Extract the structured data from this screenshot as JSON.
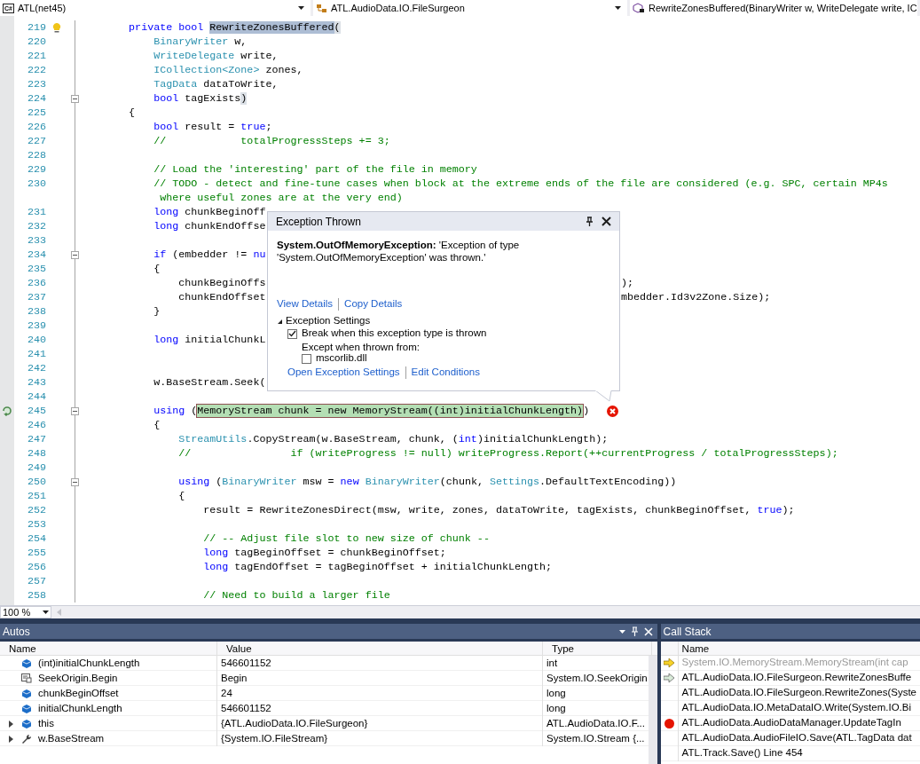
{
  "navigation_bar": {
    "project_badge": "C#",
    "project": "ATL(net45)",
    "type": "ATL.AudioData.IO.FileSurgeon",
    "member": "RewriteZonesBuffered(BinaryWriter w, WriteDelegate write, IC"
  },
  "editor": {
    "lines": [
      {
        "number": "219",
        "fold": false,
        "kind": "suggestion",
        "tokens": [
          {
            "kind": "keyword",
            "text": "        private bool "
          },
          {
            "kind": "selection",
            "text": "RewriteZonesBuffered"
          },
          {
            "kind": "brace-match",
            "text": "("
          }
        ]
      },
      {
        "number": "220",
        "fold": false,
        "tokens": [
          {
            "kind": "type",
            "text": "            BinaryWriter"
          },
          {
            "kind": "plain",
            "text": " w,"
          }
        ]
      },
      {
        "number": "221",
        "fold": false,
        "tokens": [
          {
            "kind": "type",
            "text": "            WriteDelegate"
          },
          {
            "kind": "plain",
            "text": " write,"
          }
        ]
      },
      {
        "number": "222",
        "fold": false,
        "tokens": [
          {
            "kind": "type",
            "text": "            ICollection<Zone>"
          },
          {
            "kind": "plain",
            "text": " zones,"
          }
        ]
      },
      {
        "number": "223",
        "fold": false,
        "tokens": [
          {
            "kind": "type",
            "text": "            TagData"
          },
          {
            "kind": "plain",
            "text": " dataToWrite,"
          }
        ]
      },
      {
        "number": "224",
        "fold": true,
        "tokens": [
          {
            "kind": "keyword",
            "text": "            bool"
          },
          {
            "kind": "plain",
            "text": " tagExists"
          },
          {
            "kind": "brace-match",
            "text": ")"
          }
        ]
      },
      {
        "number": "225",
        "fold": false,
        "tokens": [
          {
            "kind": "plain",
            "text": "        {"
          }
        ]
      },
      {
        "number": "226",
        "fold": false,
        "tokens": [
          {
            "kind": "keyword",
            "text": "            bool"
          },
          {
            "kind": "plain",
            "text": " result = "
          },
          {
            "kind": "keyword",
            "text": "true"
          },
          {
            "kind": "plain",
            "text": ";"
          }
        ]
      },
      {
        "number": "227",
        "fold": false,
        "tokens": [
          {
            "kind": "comment",
            "text": "            //            totalProgressSteps += 3;"
          }
        ]
      },
      {
        "number": "228",
        "fold": false
      },
      {
        "number": "229",
        "fold": false,
        "tokens": [
          {
            "kind": "comment",
            "text": "            // Load the 'interesting' part of the file in memory"
          }
        ]
      },
      {
        "number": "230",
        "fold": false,
        "tokens": [
          {
            "kind": "comment",
            "text": "            // TODO - detect and fine-tune cases when block at the extreme ends of the file are considered (e.g. SPC, certain MP4s"
          }
        ]
      },
      {
        "fold": false,
        "tokens": [
          {
            "kind": "comment",
            "text": "             where useful zones are at the very end)"
          }
        ]
      },
      {
        "number": "231",
        "fold": false,
        "tokens": [
          {
            "kind": "keyword",
            "text": "            long"
          },
          {
            "kind": "plain",
            "text": " chunkBeginOff"
          }
        ]
      },
      {
        "number": "232",
        "fold": false,
        "tokens": [
          {
            "kind": "keyword",
            "text": "            long"
          },
          {
            "kind": "plain",
            "text": " chunkEndOffse"
          }
        ]
      },
      {
        "number": "233",
        "fold": false
      },
      {
        "number": "234",
        "fold": true,
        "tokens": [
          {
            "kind": "keyword",
            "text": "            if"
          },
          {
            "kind": "plain",
            "text": " (embedder != "
          },
          {
            "kind": "keyword",
            "text": "nu"
          }
        ]
      },
      {
        "number": "235",
        "fold": false,
        "tokens": [
          {
            "kind": "plain",
            "text": "            {"
          }
        ]
      },
      {
        "number": "236",
        "fold": false,
        "tokens": [
          {
            "kind": "plain",
            "text": "                chunkBeginOffs"
          }
        ],
        "right_tokens": [
          {
            "text": ");"
          }
        ]
      },
      {
        "number": "237",
        "fold": false,
        "tokens": [
          {
            "kind": "plain",
            "text": "                chunkEndOffset"
          }
        ],
        "right_tokens": [
          {
            "text": "mbedder.Id3v2Zone.Size);"
          }
        ]
      },
      {
        "number": "238",
        "fold": false,
        "tokens": [
          {
            "kind": "plain",
            "text": "            }"
          }
        ]
      },
      {
        "number": "239",
        "fold": false
      },
      {
        "number": "240",
        "fold": false,
        "tokens": [
          {
            "kind": "keyword",
            "text": "            long"
          },
          {
            "kind": "plain",
            "text": " initialChunkL"
          }
        ]
      },
      {
        "number": "241",
        "fold": false
      },
      {
        "number": "242",
        "fold": false
      },
      {
        "number": "243",
        "fold": false,
        "tokens": [
          {
            "kind": "plain",
            "text": "            w.BaseStream.Seek("
          }
        ]
      },
      {
        "number": "244",
        "fold": false
      },
      {
        "number": "245",
        "fold": true,
        "kind": "exception-point",
        "tokens": [
          {
            "kind": "keyword",
            "text": "            using"
          },
          {
            "kind": "plain",
            "text": " ("
          },
          {
            "kind": "current-statement",
            "text": "MemoryStream chunk = new MemoryStream((int)initialChunkLength)"
          },
          {
            "kind": "plain",
            "text": ")"
          }
        ]
      },
      {
        "number": "246",
        "fold": false,
        "tokens": [
          {
            "kind": "plain",
            "text": "            {"
          }
        ]
      },
      {
        "number": "247",
        "fold": false,
        "tokens": [
          {
            "kind": "type",
            "text": "                StreamUtils"
          },
          {
            "kind": "plain",
            "text": ".CopyStream(w.BaseStream, chunk, ("
          },
          {
            "kind": "keyword",
            "text": "int"
          },
          {
            "kind": "plain",
            "text": ")initialChunkLength);"
          }
        ]
      },
      {
        "number": "248",
        "fold": false,
        "tokens": [
          {
            "kind": "comment",
            "text": "                //                if (writeProgress != null) writeProgress.Report(++currentProgress / totalProgressSteps);"
          }
        ]
      },
      {
        "number": "249",
        "fold": false
      },
      {
        "number": "250",
        "fold": true,
        "tokens": [
          {
            "kind": "keyword",
            "text": "                using"
          },
          {
            "kind": "plain",
            "text": " ("
          },
          {
            "kind": "type",
            "text": "BinaryWriter"
          },
          {
            "kind": "plain",
            "text": " msw = "
          },
          {
            "kind": "keyword",
            "text": "new "
          },
          {
            "kind": "type",
            "text": "BinaryWriter"
          },
          {
            "kind": "plain",
            "text": "(chunk, "
          },
          {
            "kind": "type",
            "text": "Settings"
          },
          {
            "kind": "plain",
            "text": ".DefaultTextEncoding))"
          }
        ]
      },
      {
        "number": "251",
        "fold": false,
        "tokens": [
          {
            "kind": "plain",
            "text": "                {"
          }
        ]
      },
      {
        "number": "252",
        "fold": false,
        "tokens": [
          {
            "kind": "plain",
            "text": "                    result = RewriteZonesDirect(msw, write, zones, dataToWrite, tagExists, chunkBeginOffset, "
          },
          {
            "kind": "keyword",
            "text": "true"
          },
          {
            "kind": "plain",
            "text": ");"
          }
        ]
      },
      {
        "number": "253",
        "fold": false
      },
      {
        "number": "254",
        "fold": false,
        "tokens": [
          {
            "kind": "comment",
            "text": "                    // -- Adjust file slot to new size of chunk --"
          }
        ]
      },
      {
        "number": "255",
        "fold": false,
        "tokens": [
          {
            "kind": "keyword",
            "text": "                    long"
          },
          {
            "kind": "plain",
            "text": " tagBeginOffset = chunkBeginOffset;"
          }
        ]
      },
      {
        "number": "256",
        "fold": false,
        "tokens": [
          {
            "kind": "keyword",
            "text": "                    long"
          },
          {
            "kind": "plain",
            "text": " tagEndOffset = tagBeginOffset + initialChunkLength;"
          }
        ]
      },
      {
        "number": "257",
        "fold": false
      },
      {
        "number": "258",
        "fold": false,
        "tokens": [
          {
            "kind": "comment",
            "text": "                    // Need to build a larger file"
          }
        ]
      }
    ],
    "zoom": "100 %"
  },
  "exception_popup": {
    "title": "Exception Thrown",
    "message": "**System.OutOfMemoryException:** 'Exception of type 'System.OutOfMemoryException' was thrown.'",
    "links": [
      "View Details",
      "Copy Details"
    ],
    "settings": {
      "title": "Exception Settings",
      "expanded": true,
      "break_option": {
        "label": "Break when this exception type is thrown",
        "checked": true
      },
      "except_label": "Except when thrown from:",
      "modules": [
        {
          "label": "mscorlib.dll",
          "checked": false
        }
      ]
    },
    "footer_links": [
      "Open Exception Settings",
      "Edit Conditions"
    ]
  },
  "autos": {
    "title": "Autos",
    "columns": [
      "Name",
      "Value",
      "Type"
    ],
    "rows": [
      {
        "name": "(int)initialChunkLength",
        "value": "546601152",
        "type": "int",
        "kind": "variable",
        "expandable": false
      },
      {
        "name": "SeekOrigin.Begin",
        "value": "Begin",
        "type": "System.IO.SeekOrigin",
        "kind": "enum-member",
        "expandable": false
      },
      {
        "name": "chunkBeginOffset",
        "value": "24",
        "type": "long",
        "kind": "variable",
        "expandable": false
      },
      {
        "name": "initialChunkLength",
        "value": "546601152",
        "type": "long",
        "kind": "variable",
        "expandable": false
      },
      {
        "name": "this",
        "value": "{ATL.AudioData.IO.FileSurgeon}",
        "type": "ATL.AudioData.IO.F...",
        "kind": "variable",
        "expandable": true
      },
      {
        "name": "w.BaseStream",
        "value": "{System.IO.FileStream}",
        "type": "System.IO.Stream {...",
        "kind": "property",
        "expandable": true
      }
    ]
  },
  "call_stack": {
    "title": "Call Stack",
    "columns": [
      "Name"
    ],
    "frames": [
      {
        "name": "System.IO.MemoryStream.MemoryStream(int cap",
        "kind": "current",
        "dimmed": true
      },
      {
        "name": "ATL.AudioData.IO.FileSurgeon.RewriteZonesBuffe",
        "kind": "return",
        "dimmed": false
      },
      {
        "name": "ATL.AudioData.IO.FileSurgeon.RewriteZones(Syste",
        "dimmed": false
      },
      {
        "name": "ATL.AudioData.IO.MetaDataIO.Write(System.IO.Bi",
        "dimmed": false
      },
      {
        "name": "ATL.AudioData.AudioDataManager.UpdateTagIn",
        "kind": "breakpoint",
        "dimmed": false
      },
      {
        "name": "ATL.AudioData.AudioFileIO.Save(ATL.TagData dat",
        "dimmed": false
      },
      {
        "name": "ATL.Track.Save() Line 454",
        "dimmed": false
      }
    ]
  }
}
